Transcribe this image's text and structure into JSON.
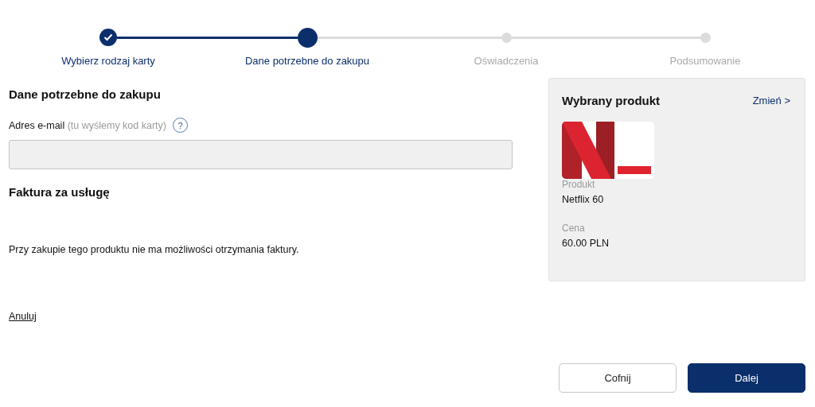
{
  "steps": [
    {
      "label": "Wybierz rodzaj karty",
      "done": true,
      "selected": false
    },
    {
      "label": "Dane potrzebne do zakupu",
      "done": false,
      "selected": true
    },
    {
      "label": "Oświadczenia",
      "done": false,
      "selected": false
    },
    {
      "label": "Podsumowanie",
      "done": false,
      "selected": false
    }
  ],
  "form": {
    "title": "Dane potrzebne do zakupu",
    "email_label": "Adres e-mail",
    "email_hint": "(tu wyślemy kod karty)",
    "help_mark": "?",
    "invoice_title": "Faktura za usługę",
    "invoice_note": "Przy zakupie tego produktu nie ma możliwości otrzymania faktury.",
    "cancel_link": "Anuluj"
  },
  "product": {
    "title": "Wybrany produkt",
    "change_link": "Zmień >",
    "name_label": "Produkt",
    "name": "Netflix 60",
    "price_label": "Cena",
    "price": "60.00 PLN"
  },
  "buttons": [
    {
      "label": "Cofnij",
      "kind": "secondary"
    },
    {
      "label": "Dalej",
      "kind": "primary"
    }
  ]
}
